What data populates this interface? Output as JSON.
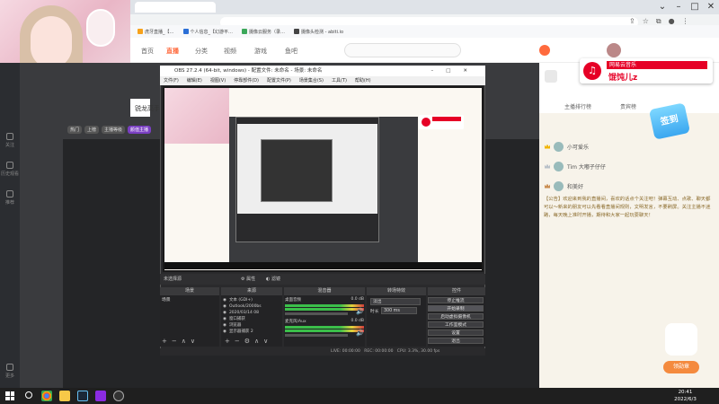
{
  "browser": {
    "tab_title": "…",
    "bookmarks": [
      "虎牙直播_【…",
      "个人信息_【幻游平…",
      "摄像云服务（录…",
      "摄像头检测 - abiti.io"
    ],
    "bookmark_colors": [
      "#f7a21b",
      "#2b6fd6",
      "#3ca85a",
      "#444444"
    ]
  },
  "site_nav": {
    "items": [
      "首页",
      "直播",
      "分类",
      "视频",
      "游戏",
      "鱼吧"
    ],
    "active": "直播"
  },
  "room": {
    "title": "锐龙高手",
    "tags": [
      "热门",
      "上榜",
      "主播等级",
      "颜值主播"
    ]
  },
  "sidebar": {
    "items": [
      "关注",
      "历史观看",
      "推荐",
      "更多"
    ]
  },
  "popup": {
    "app_name": "网易云音乐",
    "song": "馄饨儿z"
  },
  "right_panel": {
    "tabs": [
      "主播排行榜",
      "贵宾榜"
    ],
    "ranking": [
      {
        "name": "小可爱乐",
        "badge": "1"
      },
      {
        "name": "Tim 大嘟子仔仔",
        "badge": "2"
      },
      {
        "name": "和美好",
        "badge": "3"
      }
    ],
    "announcement": "【公告】欢迎来到我的直播间，喜欢的话点个关注吧！弹幕互动、点歌、聊天都可以～新来的朋友可以先看看直播间规则，文明发言，不要刷屏。关注主播不迷路，每天晚上准时开播，期待和大家一起玩耍聊天！",
    "checkin_text": "签到",
    "gift_button": "领勋章"
  },
  "obs": {
    "title": "OBS 27.2.4 (64-bit, windows) - 配置文件: 未命名 - 场景: 未命名",
    "menu": [
      "文件(F)",
      "编辑(E)",
      "视图(V)",
      "停靠部件(D)",
      "配置文件(P)",
      "场景集合(S)",
      "工具(T)",
      "帮助(H)"
    ],
    "scene_label": "未选择源",
    "scene_buttons": [
      "属性",
      "滤镜"
    ],
    "docks": [
      "场景",
      "来源",
      "混音器",
      "转场特效",
      "控件"
    ],
    "scenes": [
      "场景"
    ],
    "sources": [
      "文本 (GDI+)",
      "Outlook/2000bs",
      "2020/03/14 08",
      "窗口捕获",
      "浏览器",
      "显示器捕获 2"
    ],
    "mixer": [
      {
        "name": "桌面音频",
        "db": "0.0 dB"
      },
      {
        "name": "麦克风/Aux",
        "db": "0.0 dB"
      }
    ],
    "transition": {
      "type": "淡出",
      "duration_label": "时长",
      "duration": "300 ms"
    },
    "controls": [
      "停止推流",
      "开始录制",
      "启动虚拟摄像机",
      "工作室模式",
      "设置",
      "退出"
    ],
    "status": {
      "dropped": "LIVE: 00:00:00",
      "rec": "REC: 00:00:00",
      "cpu": "CPU: 3.3%, 30.00 fps"
    }
  },
  "taskbar": {
    "time": "20:41",
    "date": "2022/6/3",
    "apps": [
      {
        "name": "chrome",
        "color": "#f4c20d"
      },
      {
        "name": "explorer",
        "color": "#f7c948"
      },
      {
        "name": "steam",
        "color": "#1b2838"
      },
      {
        "name": "obs",
        "color": "#333333"
      },
      {
        "name": "app",
        "color": "#8a2be2"
      }
    ]
  }
}
